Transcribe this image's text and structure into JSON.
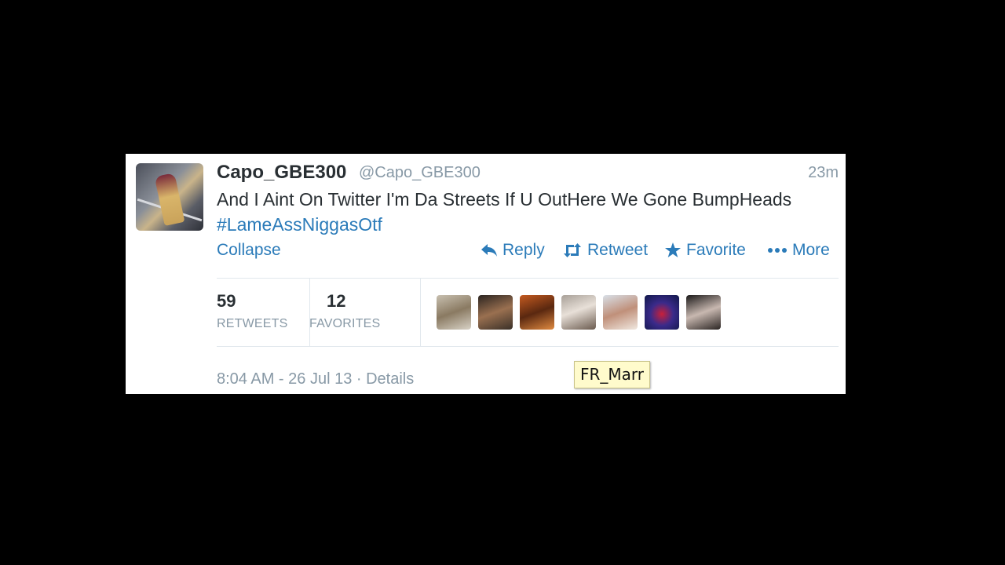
{
  "tweet": {
    "display_name": "Capo_GBE300",
    "username": "@Capo_GBE300",
    "time_ago": "23m",
    "text_main": "And I Aint On Twitter I'm Da Streets If U OutHere We Gone BumpHeads",
    "hashtag": "#LameAssNiggasOtf"
  },
  "actions": {
    "collapse": "Collapse",
    "reply": "Reply",
    "retweet": "Retweet",
    "favorite": "Favorite",
    "more": "More"
  },
  "icons": {
    "reply": "reply-arrow-icon",
    "retweet": "retweet-icon",
    "favorite": "star-icon",
    "more": "ellipsis-icon"
  },
  "stats": {
    "retweets_count": "59",
    "retweets_label": "RETWEETS",
    "favorites_count": "12",
    "favorites_label": "FAVORITES"
  },
  "footer": {
    "meta": "8:04 AM - 26 Jul 13 · Details"
  },
  "tooltip": {
    "text": "FR_Marr"
  },
  "colors": {
    "link": "#2b7bb9",
    "text": "#292f33",
    "muted": "#8899a6",
    "tooltip_bg": "#fffbcc"
  }
}
